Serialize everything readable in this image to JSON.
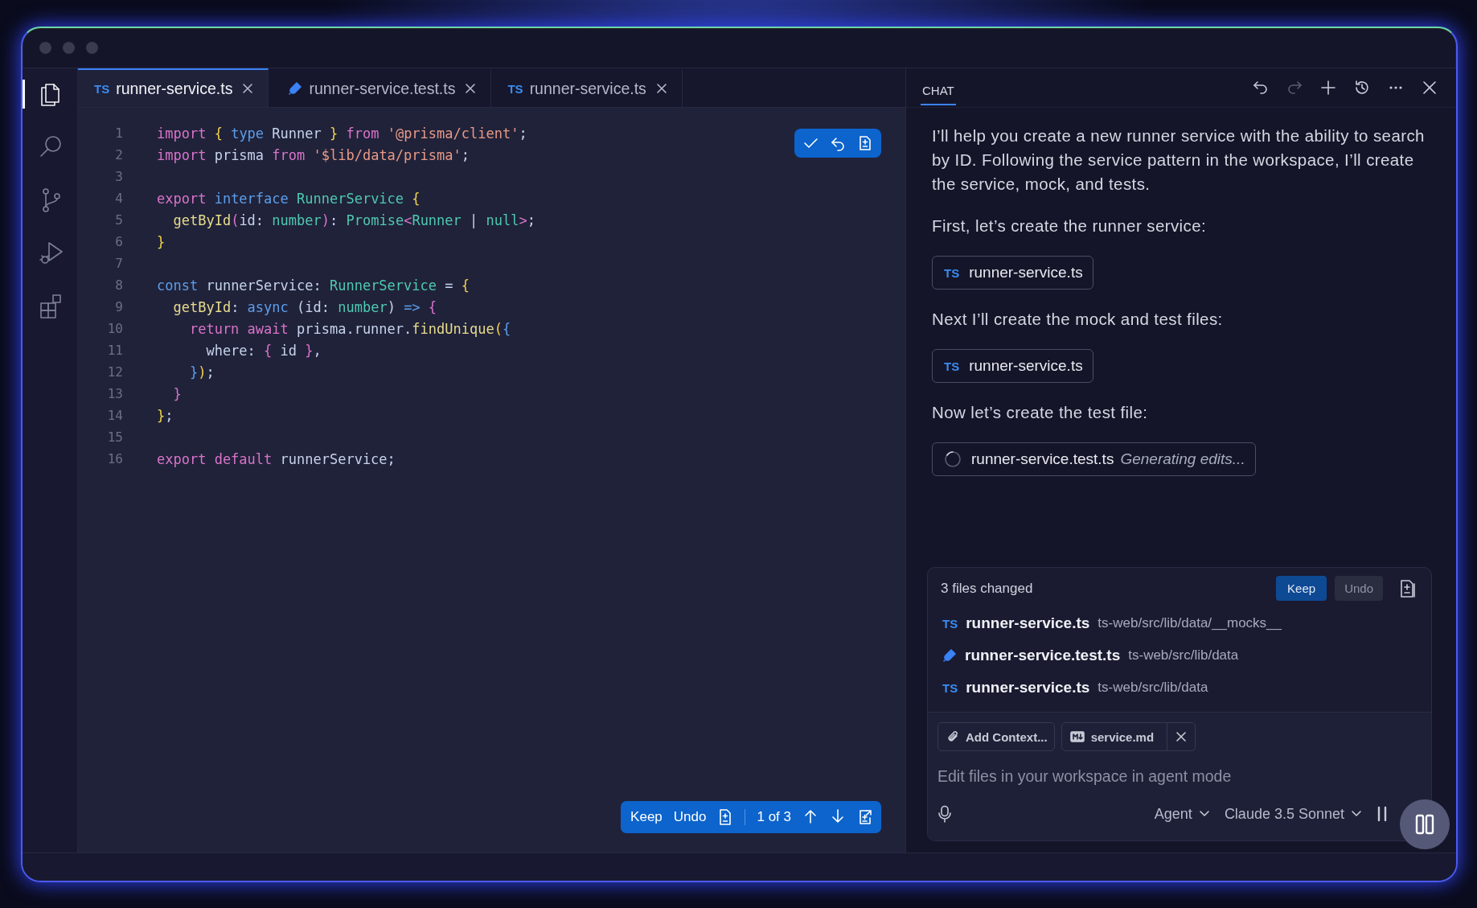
{
  "activity_bar": [
    {
      "kind": "files",
      "selected": true
    },
    {
      "kind": "search",
      "selected": false
    },
    {
      "kind": "source-control",
      "selected": false
    },
    {
      "kind": "run",
      "selected": false
    },
    {
      "kind": "extensions",
      "selected": false
    }
  ],
  "tabs": [
    {
      "kind": "ts",
      "badge": "TS",
      "label": "runner-service.ts",
      "selected": true
    },
    {
      "kind": "test",
      "label": "runner-service.test.ts",
      "selected": false
    },
    {
      "kind": "ts",
      "badge": "TS",
      "label": "runner-service.ts",
      "selected": false
    }
  ],
  "editor": {
    "lines": [
      {
        "number": "1",
        "tokens": [
          {
            "kind": "kw",
            "t": "import "
          },
          {
            "kind": "brace",
            "t": "{ "
          },
          {
            "kind": "kw2",
            "t": "type "
          },
          {
            "kind": "plain",
            "t": "Runner "
          },
          {
            "kind": "brace",
            "t": "} "
          },
          {
            "kind": "kw",
            "t": "from "
          },
          {
            "kind": "str",
            "t": "'@prisma/client'"
          },
          {
            "kind": "plain",
            "t": ";"
          }
        ]
      },
      {
        "number": "2",
        "tokens": [
          {
            "kind": "kw",
            "t": "import "
          },
          {
            "kind": "plain",
            "t": "prisma "
          },
          {
            "kind": "kw",
            "t": "from "
          },
          {
            "kind": "str",
            "t": "'$lib/data/prisma'"
          },
          {
            "kind": "plain",
            "t": ";"
          }
        ]
      },
      {
        "number": "3"
      },
      {
        "number": "4",
        "tokens": [
          {
            "kind": "kw",
            "t": "export "
          },
          {
            "kind": "kw2",
            "t": "interface "
          },
          {
            "kind": "type",
            "t": "RunnerService "
          },
          {
            "kind": "brace",
            "t": "{"
          }
        ]
      },
      {
        "number": "5",
        "tokens": [
          {
            "kind": "fn",
            "t": "  getById"
          },
          {
            "kind": "paren",
            "t": "("
          },
          {
            "kind": "plain",
            "t": "id: "
          },
          {
            "kind": "type",
            "t": "number"
          },
          {
            "kind": "paren",
            "t": ")"
          },
          {
            "kind": "plain",
            "t": ": "
          },
          {
            "kind": "type",
            "t": "Promise"
          },
          {
            "kind": "paren",
            "t": "<"
          },
          {
            "kind": "type",
            "t": "Runner "
          },
          {
            "kind": "plain",
            "t": "| "
          },
          {
            "kind": "type",
            "t": "null"
          },
          {
            "kind": "paren",
            "t": ">"
          },
          {
            "kind": "plain",
            "t": ";"
          }
        ]
      },
      {
        "number": "6",
        "tokens": [
          {
            "kind": "brace",
            "t": "}"
          }
        ]
      },
      {
        "number": "7"
      },
      {
        "number": "8",
        "tokens": [
          {
            "kind": "kw2",
            "t": "const "
          },
          {
            "kind": "plain",
            "t": "runnerService: "
          },
          {
            "kind": "type",
            "t": "RunnerService "
          },
          {
            "kind": "plain",
            "t": "= "
          },
          {
            "kind": "brace",
            "t": "{"
          }
        ]
      },
      {
        "number": "9",
        "tokens": [
          {
            "kind": "fn",
            "t": "  getById"
          },
          {
            "kind": "plain",
            "t": ": "
          },
          {
            "kind": "kw2",
            "t": "async "
          },
          {
            "kind": "plain",
            "t": "(id: "
          },
          {
            "kind": "type",
            "t": "number"
          },
          {
            "kind": "plain",
            "t": ") "
          },
          {
            "kind": "kw2",
            "t": "=> "
          },
          {
            "kind": "paren",
            "t": "{"
          }
        ]
      },
      {
        "number": "10",
        "tokens": [
          {
            "kind": "kw",
            "t": "    return await "
          },
          {
            "kind": "plain",
            "t": "prisma.runner."
          },
          {
            "kind": "fn",
            "t": "findUnique"
          },
          {
            "kind": "brace",
            "t": "("
          },
          {
            "kind": "kw2",
            "t": "{"
          }
        ]
      },
      {
        "number": "11",
        "tokens": [
          {
            "kind": "plain",
            "t": "      where: "
          },
          {
            "kind": "paren",
            "t": "{ "
          },
          {
            "kind": "plain",
            "t": "id "
          },
          {
            "kind": "paren",
            "t": "}"
          },
          {
            "kind": "plain",
            "t": ","
          }
        ]
      },
      {
        "number": "12",
        "tokens": [
          {
            "kind": "kw2",
            "t": "    }"
          },
          {
            "kind": "brace",
            "t": ")"
          },
          {
            "kind": "plain",
            "t": ";"
          }
        ]
      },
      {
        "number": "13",
        "tokens": [
          {
            "kind": "paren",
            "t": "  }"
          }
        ]
      },
      {
        "number": "14",
        "tokens": [
          {
            "kind": "brace",
            "t": "}"
          },
          {
            "kind": "plain",
            "t": ";"
          }
        ]
      },
      {
        "number": "15"
      },
      {
        "number": "16",
        "tokens": [
          {
            "kind": "kw",
            "t": "export default "
          },
          {
            "kind": "plain",
            "t": "runnerService;"
          }
        ]
      }
    ]
  },
  "review_bar": {
    "keep": "Keep",
    "undo": "Undo",
    "position": "1 of 3"
  },
  "chat": {
    "title": "CHAT",
    "actions": [
      {
        "kind": "undo",
        "disabled": false
      },
      {
        "kind": "redo",
        "disabled": true
      },
      {
        "kind": "new",
        "disabled": false
      },
      {
        "kind": "history",
        "disabled": false
      },
      {
        "kind": "more",
        "disabled": false
      },
      {
        "kind": "close",
        "disabled": false
      }
    ],
    "messages": [
      {
        "kind": "text",
        "text": "I’ll help you create a new runner service with the ability to search by ID. Following the service pattern in the workspace, I’ll create the service, mock, and tests."
      },
      {
        "kind": "text",
        "text": "First, let’s create the runner service:"
      },
      {
        "kind": "file",
        "badge": "TS",
        "label": "runner-service.ts"
      },
      {
        "kind": "text",
        "text": "Next I’ll create the mock and test files:"
      },
      {
        "kind": "file",
        "badge": "TS",
        "label": "runner-service.ts"
      },
      {
        "kind": "text",
        "text": "Now let’s create the test file:"
      },
      {
        "kind": "pending",
        "label": "runner-service.test.ts",
        "status": "Generating edits..."
      }
    ]
  },
  "changes": {
    "summary": "3 files changed",
    "keep": "Keep",
    "undo": "Undo",
    "files": [
      {
        "kind": "ts",
        "badge": "TS",
        "name": "runner-service.ts",
        "path": "ts-web/src/lib/data/__mocks__"
      },
      {
        "kind": "test",
        "name": "runner-service.test.ts",
        "path": "ts-web/src/lib/data"
      },
      {
        "kind": "ts",
        "badge": "TS",
        "name": "runner-service.ts",
        "path": "ts-web/src/lib/data"
      }
    ]
  },
  "input": {
    "attachments": [
      {
        "kind": "add",
        "label": "Add Context...",
        "removable": false
      },
      {
        "kind": "markdown",
        "label": "service.md",
        "removable": true
      }
    ],
    "placeholder": "Edit files in your workspace in agent mode",
    "mode": "Agent",
    "model": "Claude 3.5 Sonnet"
  }
}
